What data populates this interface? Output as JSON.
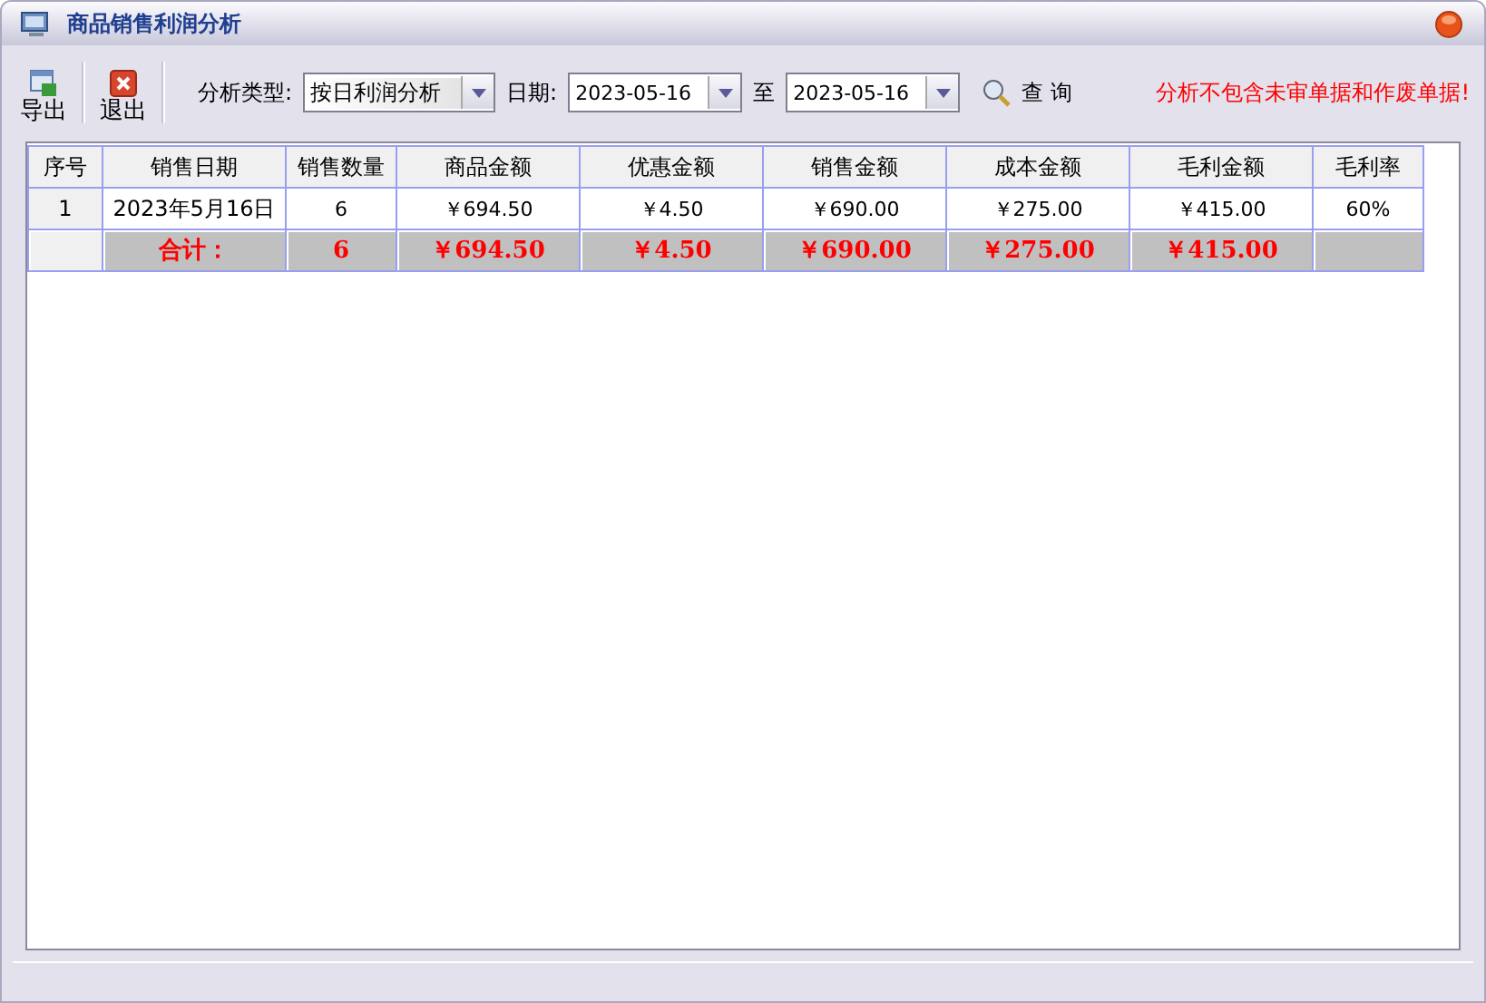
{
  "window": {
    "title": "商品销售利润分析"
  },
  "toolbar": {
    "buttons": [
      {
        "kind": "export",
        "label": "导出"
      },
      {
        "kind": "exit",
        "label": "退出"
      }
    ],
    "analysis_type": {
      "label": "分析类型:",
      "value": "按日利润分析"
    },
    "date": {
      "label": "日期:",
      "from": "2023-05-16",
      "to_label": "至",
      "to": "2023-05-16"
    },
    "query": {
      "label": "查 询"
    },
    "notice": "分析不包含未审单据和作废单据!"
  },
  "table": {
    "columns": [
      "序号",
      "销售日期",
      "销售数量",
      "商品金额",
      "优惠金额",
      "销售金额",
      "成本金额",
      "毛利金额",
      "毛利率"
    ],
    "rows": [
      [
        "1",
        "2023年5月16日",
        "6",
        "￥694.50",
        "￥4.50",
        "￥690.00",
        "￥275.00",
        "￥415.00",
        "60%"
      ]
    ],
    "total": {
      "label": "合计：",
      "values": [
        "6",
        "￥694.50",
        "￥4.50",
        "￥690.00",
        "￥275.00",
        "￥415.00"
      ]
    }
  }
}
